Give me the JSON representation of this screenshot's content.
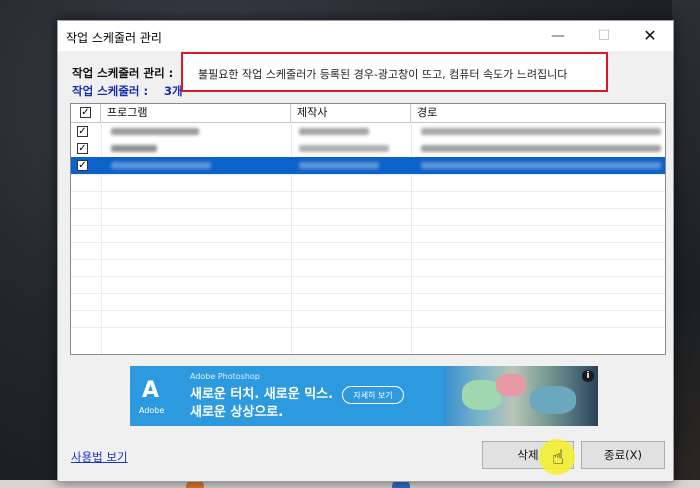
{
  "window": {
    "title": "작업 스케줄러 관리"
  },
  "labels": {
    "manage": "작업 스케줄러 관리 :",
    "count_label": "작업 스케줄러 :",
    "count_value": "3개"
  },
  "callout": {
    "text": "불필요한 작업 스케줄러가 등록된 경우-광고창이 뜨고, 컴퓨터 속도가 느려집니다",
    "border_color": "#d7192e"
  },
  "list": {
    "columns": [
      "프로그램",
      "제작사",
      "경로"
    ],
    "rows": [
      {
        "checked": true,
        "selected": false
      },
      {
        "checked": true,
        "selected": false
      },
      {
        "checked": true,
        "selected": true
      }
    ],
    "selection_color": "#0b62c9"
  },
  "ad": {
    "brand_small": "Adobe Photoshop",
    "line1": "새로운 터치. 새로운 믹스.",
    "line2": "새로운 상상으로.",
    "cta": "자세히 보기",
    "logo_text": "Adobe",
    "info": "i",
    "background": "#2d9ae0"
  },
  "footer": {
    "help_link": "사용법 보기",
    "delete_button": "삭제",
    "close_button": "종료(X)"
  },
  "icons": {
    "minimize": "minimize-icon",
    "maximize": "maximize-icon",
    "close": "close-icon",
    "cursor": "hand-cursor-icon"
  }
}
